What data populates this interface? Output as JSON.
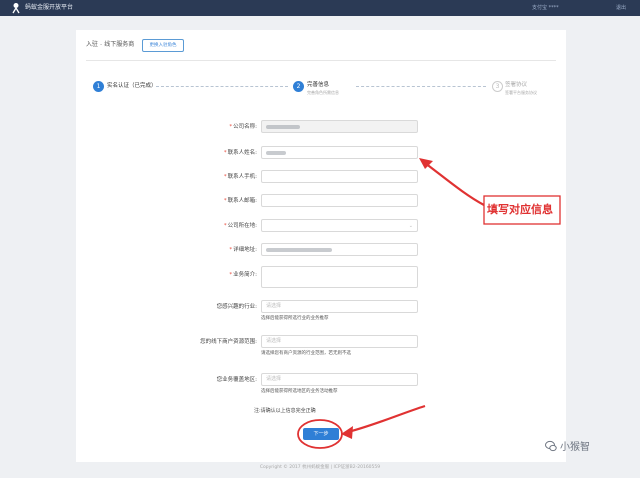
{
  "app": {
    "title": "蚂蚁金服开放平台",
    "user": "支付宝 ****",
    "logout": "退出"
  },
  "breadcrumb": {
    "root": "入驻",
    "sep": "-",
    "current": "线下服务商",
    "change_role": "更换入驻角色"
  },
  "steps": [
    {
      "num": "1",
      "title": "实名认证（已完成）",
      "sub": ""
    },
    {
      "num": "2",
      "title": "完善信息",
      "sub": "完善角色所需信息"
    },
    {
      "num": "3",
      "title": "签署协议",
      "sub": "签署平台服务协议"
    }
  ],
  "form": {
    "required_mark": "*",
    "fields": [
      {
        "label": "公司名称:",
        "required": true,
        "placeholder": ""
      },
      {
        "label": "联系人姓名:",
        "required": true,
        "placeholder": ""
      },
      {
        "label": "联系人手机:",
        "required": true,
        "placeholder": ""
      },
      {
        "label": "联系人邮箱:",
        "required": true,
        "placeholder": ""
      },
      {
        "label": "公司所在地:",
        "required": true,
        "placeholder": ""
      },
      {
        "label": "详细地址:",
        "required": true,
        "placeholder": ""
      },
      {
        "label": "业务简介:",
        "required": true,
        "placeholder": ""
      },
      {
        "label": "您感兴趣的行业:",
        "required": false,
        "placeholder": "请选择",
        "hint": "选择后能获得所选行业的业务推荐"
      },
      {
        "label": "您的线下商户资源范围:",
        "required": false,
        "placeholder": "请选择",
        "hint": "请选择您有商户资源的行业范围，若无则不选"
      },
      {
        "label": "您业务覆盖地区:",
        "required": false,
        "placeholder": "请选择",
        "hint": "选择后能获得所选地区的业务活动推荐"
      }
    ],
    "confirm": "注:请确认以上信息完全正确",
    "next_label": "下一步"
  },
  "annotation": {
    "text": "填写对应信息",
    "color": "#e03232"
  },
  "footer": "Copyright © 2017 杭州蚂蚁金服 | ICP证浙B2-20160559",
  "watermark": "小猴智"
}
